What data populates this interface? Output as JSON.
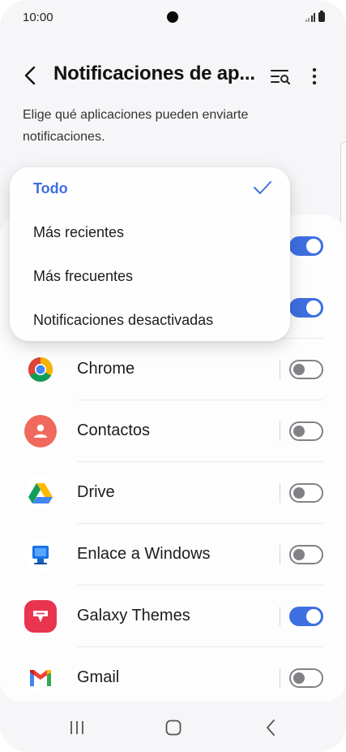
{
  "status_bar": {
    "time": "10:00"
  },
  "header": {
    "title": "Notificaciones de ap..."
  },
  "description": "Elige qué aplicaciones pueden enviarte notificaciones.",
  "sort_menu": {
    "items": [
      {
        "label": "Todo",
        "selected": true
      },
      {
        "label": "Más recientes",
        "selected": false
      },
      {
        "label": "Más frecuentes",
        "selected": false
      },
      {
        "label": "Notificaciones desactivadas",
        "selected": false
      }
    ]
  },
  "hidden_rows": [
    {
      "toggle": "on"
    },
    {
      "toggle": "on"
    }
  ],
  "apps": [
    {
      "name": "Chrome",
      "icon": "chrome-icon",
      "enabled": false
    },
    {
      "name": "Contactos",
      "icon": "contacts-icon",
      "enabled": false
    },
    {
      "name": "Drive",
      "icon": "drive-icon",
      "enabled": false
    },
    {
      "name": "Enlace a Windows",
      "icon": "link-to-windows-icon",
      "enabled": false
    },
    {
      "name": "Galaxy Themes",
      "icon": "galaxy-themes-icon",
      "enabled": true
    },
    {
      "name": "Gmail",
      "icon": "gmail-icon",
      "enabled": false
    }
  ],
  "colors": {
    "accent": "#3d6fe0",
    "toggle_off": "#828286",
    "background": "#f6f6f8"
  },
  "navbar": {
    "buttons": [
      "recents-icon",
      "home-icon",
      "back-icon"
    ]
  }
}
